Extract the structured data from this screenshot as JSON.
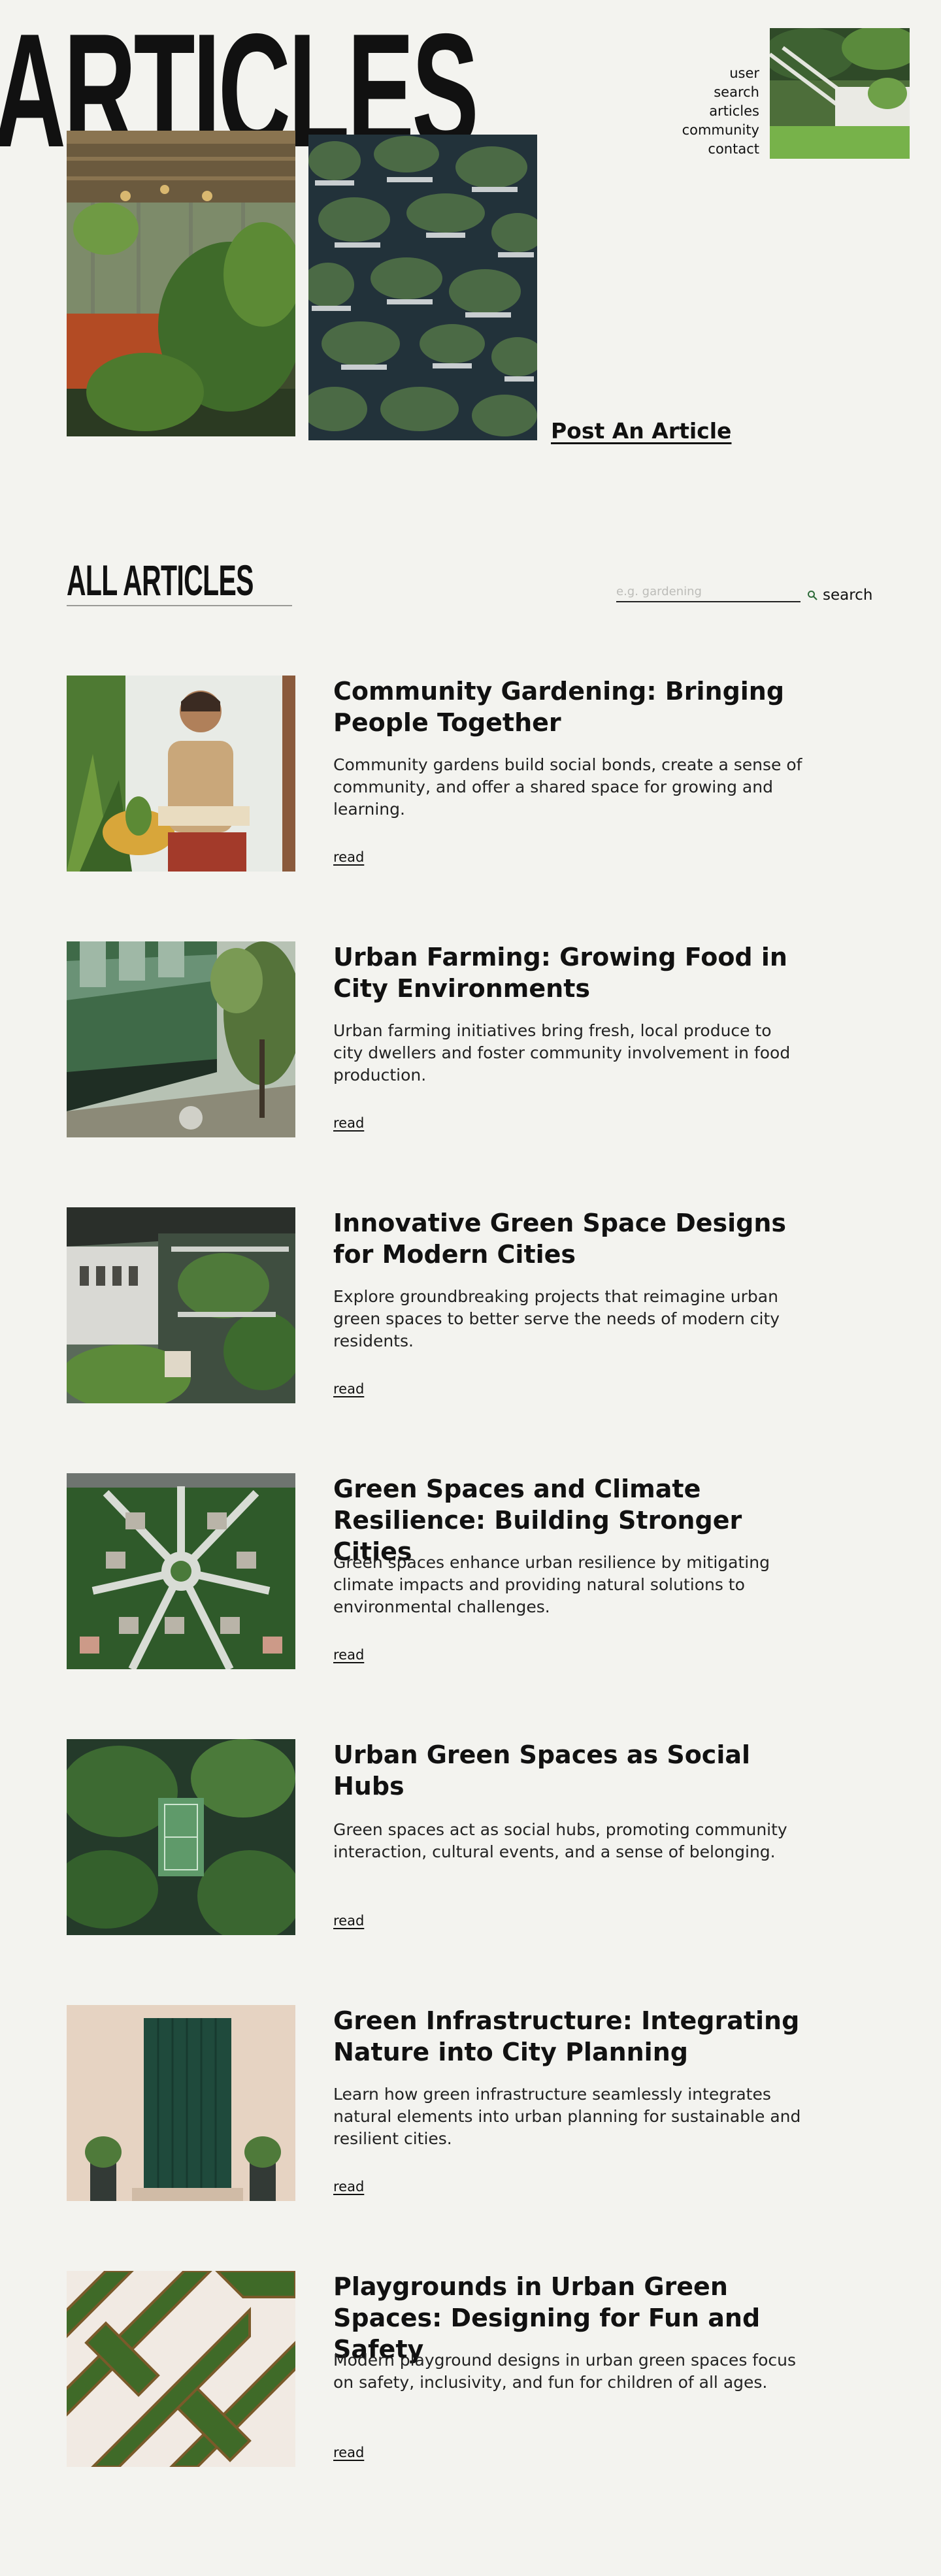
{
  "hero": {
    "title": "ARTICLES",
    "post_link": "Post An Article"
  },
  "nav": {
    "items": [
      "user",
      "search",
      "articles",
      "community",
      "contact"
    ]
  },
  "section": {
    "title": "ALL ARTICLES"
  },
  "search": {
    "placeholder": "e.g. gardening",
    "value": "",
    "button_label": "search",
    "icon": "search-icon"
  },
  "articles": [
    {
      "title": "Community Gardening: Bringing People Together",
      "description": "Community gardens build social bonds, create a sense of community, and offer a shared space for growing and learning.",
      "read_label": "read"
    },
    {
      "title": "Urban Farming: Growing Food in City Environments",
      "description": "Urban farming initiatives bring fresh, local produce to city dwellers and foster community involvement in food production.",
      "read_label": "read"
    },
    {
      "title": "Innovative Green Space Designs for Modern Cities",
      "description": "Explore groundbreaking projects that reimagine urban green spaces to better serve the needs of modern city residents.",
      "read_label": "read"
    },
    {
      "title": "Green Spaces and Climate Resilience: Building Stronger Cities",
      "description": "Green spaces enhance urban resilience by mitigating climate impacts and providing natural solutions to environmental challenges.",
      "read_label": "read"
    },
    {
      "title": "Urban Green Spaces as Social Hubs",
      "description": "Green spaces act as social hubs, promoting community interaction, cultural events, and a sense of belonging.",
      "read_label": "read"
    },
    {
      "title": "Green Infrastructure: Integrating Nature into City Planning",
      "description": "Learn how green infrastructure seamlessly integrates natural elements into urban planning for sustainable and resilient cities.",
      "read_label": "read"
    },
    {
      "title": "Playgrounds in Urban Green Spaces: Designing for Fun and Safety",
      "description": "Modern playground designs in urban green spaces focus on safety, inclusivity, and fun for children of all ages.",
      "read_label": "read"
    }
  ],
  "colors": {
    "background": "#f3f3ef",
    "text": "#111111",
    "accent_green": "#2e6b3a"
  }
}
